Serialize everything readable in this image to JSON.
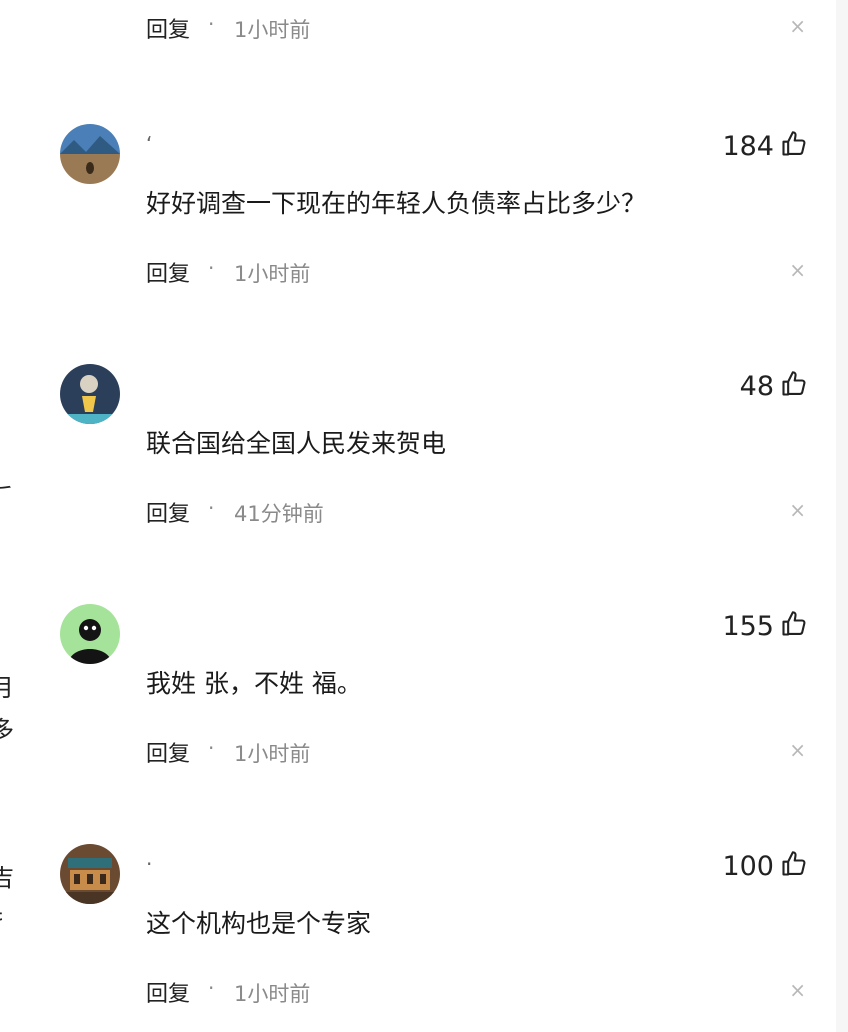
{
  "reply_label": "回复",
  "separator": "·",
  "close_glyph": "×",
  "top_row": {
    "time": "1小时前"
  },
  "comments": [
    {
      "username": "‘",
      "likes": "184",
      "text": "好好调查一下现在的年轻人负债率占比多少？",
      "time": "1小时前"
    },
    {
      "username": "",
      "likes": "48",
      "text": "联合国给全国人民发来贺电",
      "time": "41分钟前"
    },
    {
      "username": "",
      "likes": "155",
      "text": "我姓 张，不姓 福。",
      "time": "1小时前"
    },
    {
      "username": "·",
      "likes": "100",
      "text": "这个机构也是个专家",
      "time": "1小时前"
    }
  ],
  "left_edge_glyphs": [
    "𠂆",
    "月",
    "多",
    "吉",
    "扌"
  ]
}
